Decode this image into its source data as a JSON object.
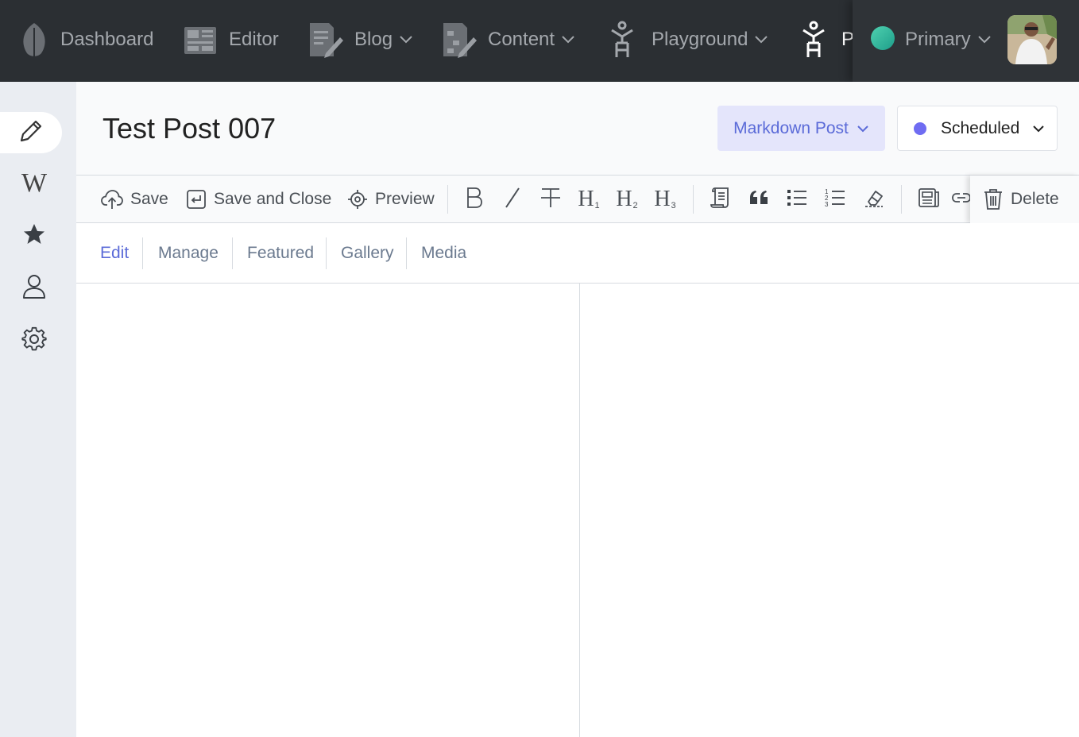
{
  "nav": {
    "items": [
      {
        "label": "Dashboard",
        "icon": "leaf-icon"
      },
      {
        "label": "Editor",
        "icon": "newspaper-icon"
      },
      {
        "label": "Blog",
        "icon": "pencil-document-icon"
      },
      {
        "label": "Content",
        "icon": "content-document-icon"
      },
      {
        "label": "Playground",
        "icon": "figure-icon"
      },
      {
        "label": "P",
        "icon": "figure-icon"
      }
    ],
    "site": {
      "label": "Primary",
      "color": "#2bb39a"
    }
  },
  "sidebar": {
    "items": [
      {
        "name": "edit",
        "icon": "pencil-icon",
        "active": true
      },
      {
        "name": "wiki",
        "icon": "wikipedia-icon",
        "glyph": "W"
      },
      {
        "name": "favorites",
        "icon": "star-icon"
      },
      {
        "name": "user",
        "icon": "user-icon"
      },
      {
        "name": "settings",
        "icon": "gear-icon"
      }
    ]
  },
  "header": {
    "title": "Test Post 007",
    "type_label": "Markdown Post",
    "status_label": "Scheduled",
    "status_color": "#6f6cf2",
    "accent": "#5b6bd8"
  },
  "toolbar": {
    "save": "Save",
    "save_close": "Save and Close",
    "preview": "Preview",
    "delete": "Delete",
    "h1_sub": "1",
    "h2_sub": "2",
    "h3_sub": "3"
  },
  "tabs": [
    "Edit",
    "Manage",
    "Featured",
    "Gallery",
    "Media"
  ]
}
